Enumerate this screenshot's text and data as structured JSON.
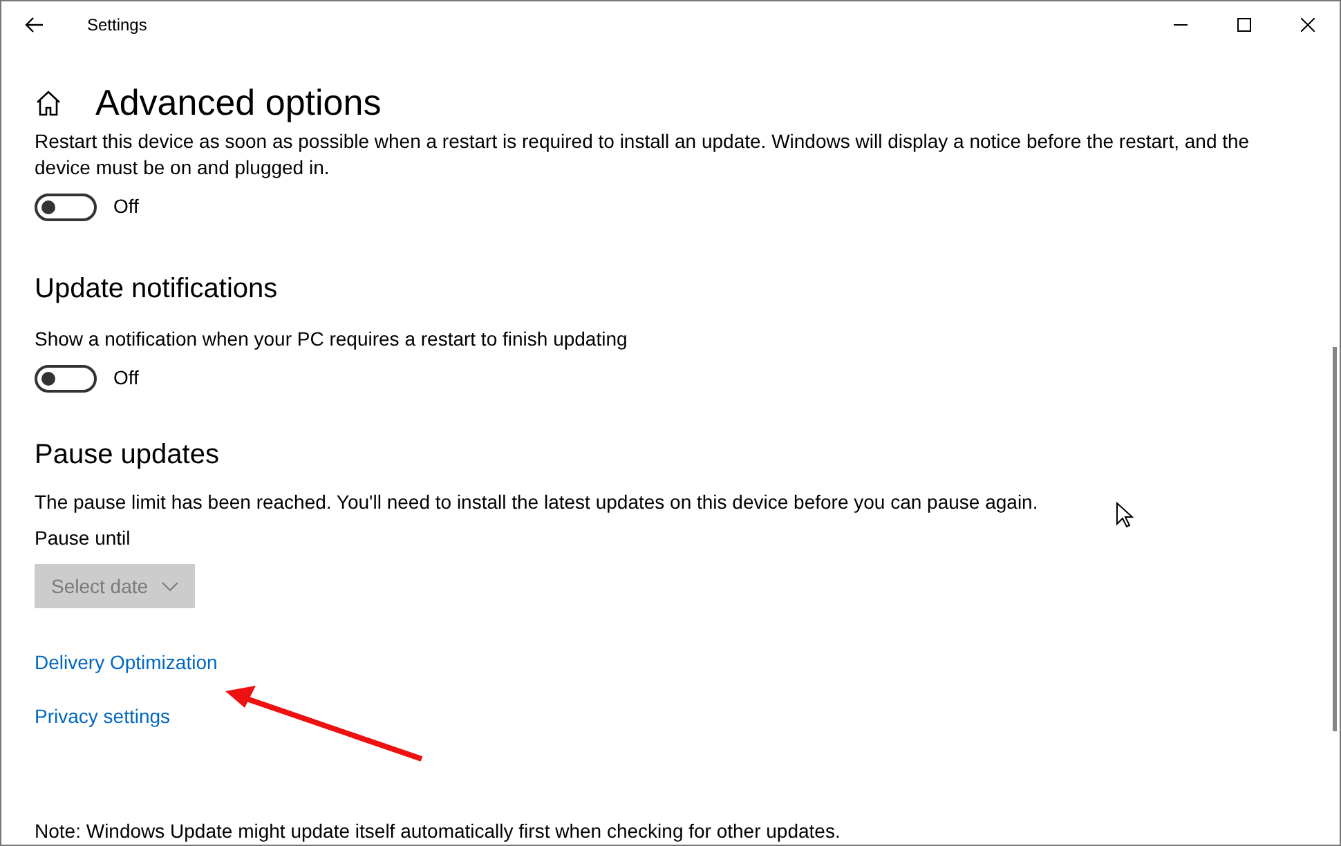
{
  "window": {
    "title": "Settings"
  },
  "page": {
    "title": "Advanced options"
  },
  "sections": [
    {
      "description": "Restart this device as soon as possible when a restart is required to install an update. Windows will display a notice before the restart, and the device must be on and plugged in.",
      "toggle": {
        "on": false,
        "label": "Off"
      }
    },
    {
      "heading": "Update notifications",
      "description": "Show a notification when your PC requires a restart to finish updating",
      "toggle": {
        "on": false,
        "label": "Off"
      }
    }
  ],
  "pause": {
    "heading": "Pause updates",
    "description": "The pause limit has been reached. You'll need to install the latest updates on this device before you can pause again.",
    "label": "Pause until",
    "select": {
      "placeholder": "Select date",
      "disabled": true
    }
  },
  "links": [
    {
      "label": "Delivery Optimization"
    },
    {
      "label": "Privacy settings"
    }
  ],
  "note": "Note: Windows Update might update itself automatically first when checking for other updates."
}
